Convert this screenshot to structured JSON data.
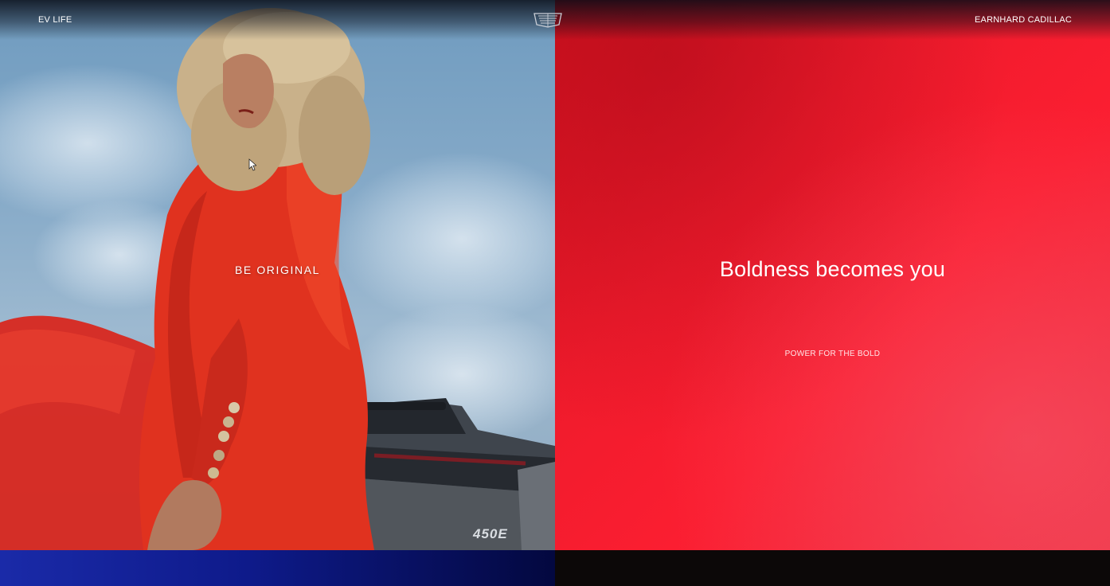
{
  "nav": {
    "left_link": "EV LIFE",
    "right_link": "EARNHARD CADILLAC",
    "logo_icon": "cadillac-crest-icon"
  },
  "hero_left": {
    "heading": "BE ORIGINAL",
    "badge_text": "450E"
  },
  "hero_right": {
    "heading": "Boldness becomes you",
    "subheading": "POWER FOR THE BOLD"
  },
  "colors": {
    "accent_red": "#f01b2c",
    "bottom_blue": "#0e1a8a",
    "bottom_dark": "#0c0808"
  }
}
